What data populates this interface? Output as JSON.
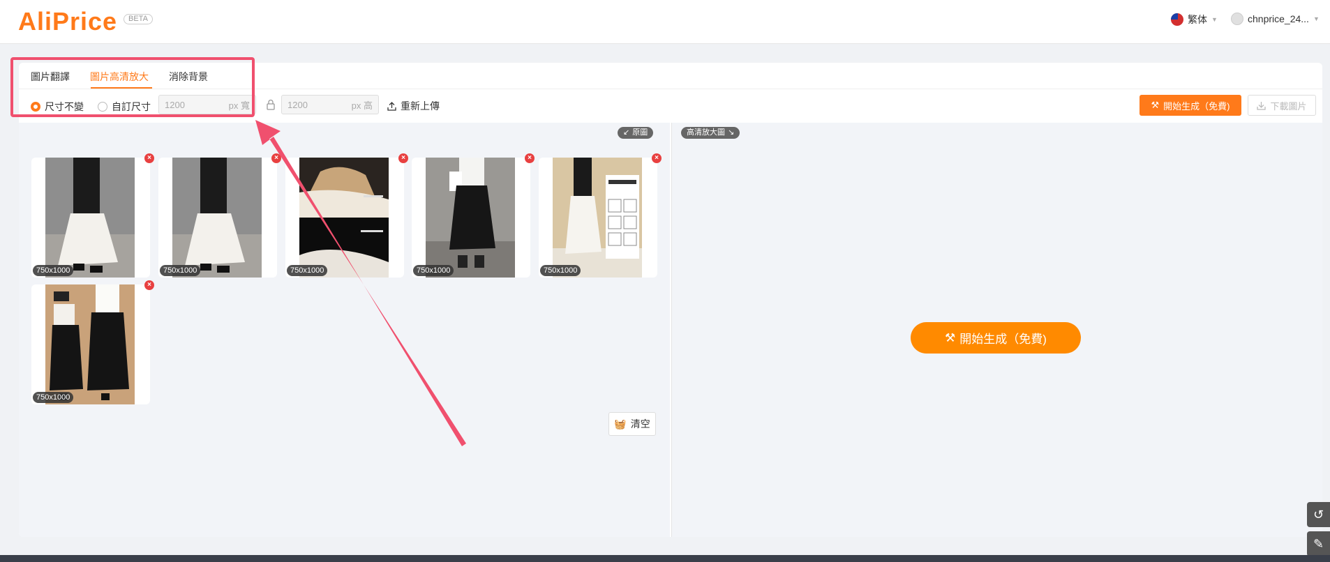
{
  "header": {
    "logo": "AliPrice",
    "beta": "BETA",
    "language": "繁体",
    "username": "chnprice_24..."
  },
  "tabs": [
    {
      "label": "圖片翻譯",
      "active": false
    },
    {
      "label": "圖片高清放大",
      "active": true
    },
    {
      "label": "消除背景",
      "active": false
    }
  ],
  "toolbar": {
    "radio_keep": "尺寸不變",
    "radio_custom": "自訂尺寸",
    "width_placeholder": "1200",
    "width_unit": "px 寬",
    "height_placeholder": "1200",
    "height_unit": "px 高",
    "reupload": "重新上傳",
    "generate": "開始生成（免費)",
    "download": "下載圖片"
  },
  "left_pane": {
    "original_label": "原圖",
    "thumbnails": [
      {
        "size": "750x1000"
      },
      {
        "size": "750x1000"
      },
      {
        "size": "750x1000"
      },
      {
        "size": "750x1000"
      },
      {
        "size": "750x1000"
      },
      {
        "size": "750x1000"
      }
    ],
    "clear": "清空"
  },
  "right_pane": {
    "hd_label": "高清放大圖",
    "generate_big": "開始生成（免費)"
  },
  "colors": {
    "accent": "#ff7a1a",
    "annotation": "#f0506e"
  }
}
